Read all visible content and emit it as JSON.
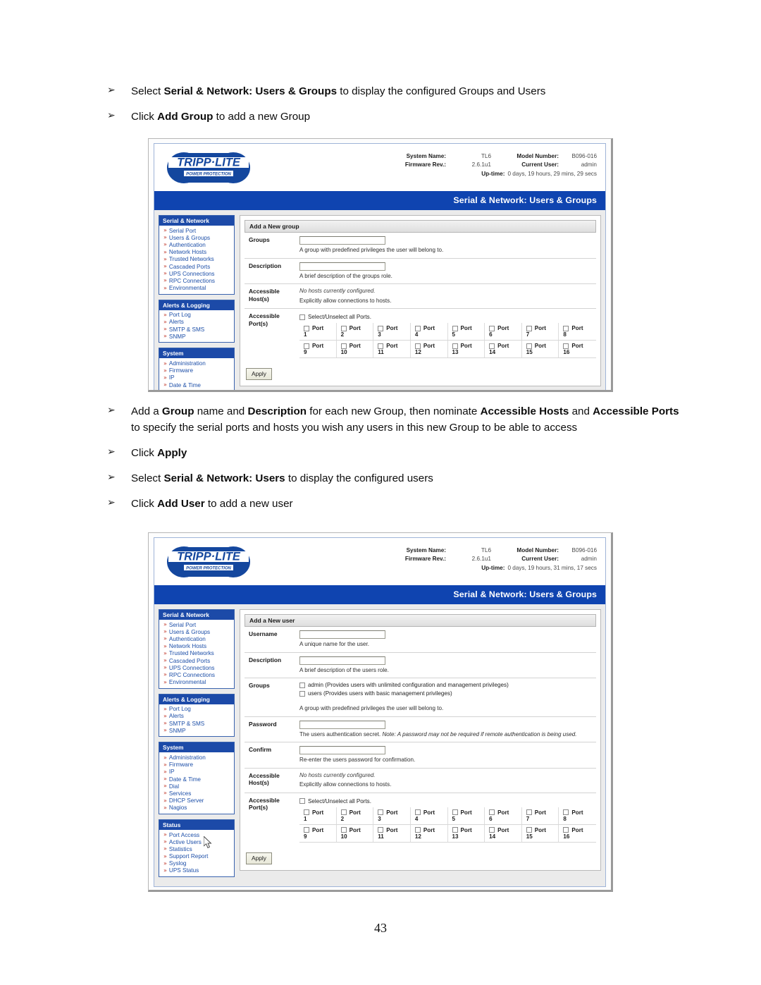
{
  "page": {
    "number": "43"
  },
  "instructions_top": [
    {
      "parts": [
        {
          "t": "Select ",
          "b": false
        },
        {
          "t": "Serial & Network: Users & Groups",
          "b": true
        },
        {
          "t": " to display the configured Groups and Users",
          "b": false
        }
      ]
    },
    {
      "parts": [
        {
          "t": "Click ",
          "b": false
        },
        {
          "t": "Add Group",
          "b": true
        },
        {
          "t": " to add a new Group",
          "b": false
        }
      ]
    }
  ],
  "instructions_mid": [
    {
      "parts": [
        {
          "t": "Add a ",
          "b": false
        },
        {
          "t": "Group",
          "b": true
        },
        {
          "t": " name and ",
          "b": false
        },
        {
          "t": "Description",
          "b": true
        },
        {
          "t": " for each new Group, then nominate ",
          "b": false
        },
        {
          "t": "Accessible Hosts",
          "b": true
        },
        {
          "t": " and ",
          "b": false
        },
        {
          "t": "Accessible Ports",
          "b": true
        },
        {
          "t": " to specify the serial ports and hosts you wish any users in this new Group to be able to access",
          "b": false
        }
      ]
    },
    {
      "parts": [
        {
          "t": "Click ",
          "b": false
        },
        {
          "t": "Apply",
          "b": true
        }
      ]
    },
    {
      "parts": [
        {
          "t": "Select ",
          "b": false
        },
        {
          "t": "Serial & Network: Users",
          "b": true
        },
        {
          "t": " to display the configured users",
          "b": false
        }
      ]
    },
    {
      "parts": [
        {
          "t": "Click ",
          "b": false
        },
        {
          "t": "Add User",
          "b": true
        },
        {
          "t": " to add a new user",
          "b": false
        }
      ]
    }
  ],
  "bullet_glyph": "➢",
  "nav_marker_glyph": "»",
  "colors": {
    "title_blue": "#0f44b0",
    "nav_head_blue": "#1c4aa8",
    "nav_link_blue": "#1d4fa8",
    "nav_marker_red": "#c0392b",
    "panel_grey": "#ebebeb"
  },
  "screenshot_group": {
    "header": {
      "logo_top": "TRIPP·LITE",
      "logo_sub": "POWER PROTECTION",
      "system_name_label": "System Name:",
      "system_name_value": "TL6",
      "model_number_label": "Model Number:",
      "model_number_value": "B096-016",
      "firmware_label": "Firmware Rev.:",
      "firmware_value": "2.6.1u1",
      "current_user_label": "Current User:",
      "current_user_value": "admin",
      "uptime_label": "Up-time:",
      "uptime_value": "0 days, 19 hours, 29 mins, 29 secs"
    },
    "titlebar": "Serial & Network: Users & Groups",
    "sidebar": [
      {
        "title": "Serial & Network",
        "items": [
          "Serial Port",
          "Users & Groups",
          "Authentication",
          "Network Hosts",
          "Trusted Networks",
          "Cascaded Ports",
          "UPS Connections",
          "RPC Connections",
          "Environmental"
        ]
      },
      {
        "title": "Alerts & Logging",
        "items": [
          "Port Log",
          "Alerts",
          "SMTP & SMS",
          "SNMP"
        ]
      },
      {
        "title": "System",
        "items": [
          "Administration",
          "Firmware",
          "IP",
          "Date & Time"
        ]
      }
    ],
    "panel_title": "Add a New group",
    "fields": [
      {
        "label": "Groups",
        "type": "text",
        "value": "",
        "hint": "A group with predefined privileges the user will belong to."
      },
      {
        "label": "Description",
        "type": "text",
        "value": "",
        "hint": "A brief description of the groups role."
      },
      {
        "label": "Accessible Host(s)",
        "type": "static",
        "italic": "No hosts currently configured.",
        "hint": "Explicitly allow connections to hosts."
      }
    ],
    "ports": {
      "label": "Accessible Port(s)",
      "select_all_label": "Select/Unselect all Ports.",
      "port_word": "Port",
      "numbers": [
        "1",
        "2",
        "3",
        "4",
        "5",
        "6",
        "7",
        "8",
        "9",
        "10",
        "11",
        "12",
        "13",
        "14",
        "15",
        "16"
      ]
    },
    "apply_label": "Apply"
  },
  "screenshot_user": {
    "header": {
      "logo_top": "TRIPP·LITE",
      "logo_sub": "POWER PROTECTION",
      "system_name_label": "System Name:",
      "system_name_value": "TL6",
      "model_number_label": "Model Number:",
      "model_number_value": "B096-016",
      "firmware_label": "Firmware Rev.:",
      "firmware_value": "2.6.1u1",
      "current_user_label": "Current User:",
      "current_user_value": "admin",
      "uptime_label": "Up-time:",
      "uptime_value": "0 days, 19 hours, 31 mins, 17 secs"
    },
    "titlebar": "Serial & Network: Users & Groups",
    "sidebar": [
      {
        "title": "Serial & Network",
        "items": [
          "Serial Port",
          "Users & Groups",
          "Authentication",
          "Network Hosts",
          "Trusted Networks",
          "Cascaded Ports",
          "UPS Connections",
          "RPC Connections",
          "Environmental"
        ]
      },
      {
        "title": "Alerts & Logging",
        "items": [
          "Port Log",
          "Alerts",
          "SMTP & SMS",
          "SNMP"
        ]
      },
      {
        "title": "System",
        "items": [
          "Administration",
          "Firmware",
          "IP",
          "Date & Time",
          "Dial",
          "Services",
          "DHCP Server",
          "Nagios"
        ]
      },
      {
        "title": "Status",
        "items": [
          "Port Access",
          "Active Users",
          "Statistics",
          "Support Report",
          "Syslog",
          "UPS Status"
        ]
      }
    ],
    "panel_title": "Add a New user",
    "fields": [
      {
        "label": "Username",
        "type": "text",
        "value": "",
        "hint": "A unique name for the user."
      },
      {
        "label": "Description",
        "type": "text",
        "value": "",
        "hint": "A brief description of the users role."
      },
      {
        "label": "Groups",
        "type": "checkboxes",
        "options": [
          "admin (Provides users with unlimited configuration and management privileges)",
          "users (Provides users with basic management privileges)"
        ],
        "hint": "A group with predefined privileges the user will belong to."
      },
      {
        "label": "Password",
        "type": "text",
        "value": "",
        "hint_plain": "The users authentication secret. ",
        "hint_italic": "Note: A password may not be required if remote authentication is being used."
      },
      {
        "label": "Confirm",
        "type": "text",
        "value": "",
        "hint": "Re-enter the users password for confirmation."
      },
      {
        "label": "Accessible Host(s)",
        "type": "static",
        "italic": "No hosts currently configured.",
        "hint": "Explicitly allow connections to hosts."
      }
    ],
    "ports": {
      "label": "Accessible Port(s)",
      "select_all_label": "Select/Unselect all Ports.",
      "port_word": "Port",
      "numbers": [
        "1",
        "2",
        "3",
        "4",
        "5",
        "6",
        "7",
        "8",
        "9",
        "10",
        "11",
        "12",
        "13",
        "14",
        "15",
        "16"
      ]
    },
    "apply_label": "Apply"
  }
}
